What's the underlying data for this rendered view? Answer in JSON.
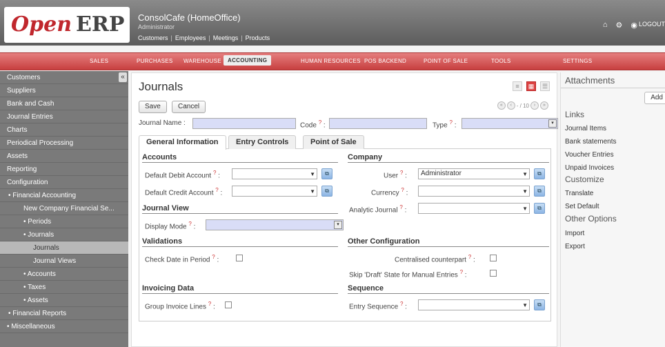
{
  "header": {
    "logo_open": "Open",
    "logo_erp": "ERP",
    "company": "ConsolCafe (HomeOffice)",
    "user": "Administrator",
    "shortcuts": [
      "Customers",
      "Employees",
      "Meetings",
      "Products"
    ],
    "logout": "LOGOUT"
  },
  "menu": [
    "SALES",
    "PURCHASES",
    "WAREHOUSE",
    "ACCOUNTING",
    "HUMAN RESOURCES",
    "POS BACKEND",
    "POINT OF SALE",
    "TOOLS",
    "SETTINGS"
  ],
  "menu_active": "ACCOUNTING",
  "sidebar": {
    "items": [
      "Customers",
      "Suppliers",
      "Bank and Cash",
      "Journal Entries",
      "Charts",
      "Periodical Processing",
      "Assets",
      "Reporting",
      "Configuration",
      "• Financial Accounting",
      "New Company Financial Se...",
      "• Periods",
      "• Journals",
      "Journals",
      "Journal Views",
      "• Accounts",
      "• Taxes",
      "• Assets",
      "• Financial Reports",
      "• Miscellaneous"
    ],
    "collapse": "«"
  },
  "main": {
    "title": "Journals",
    "save": "Save",
    "cancel": "Cancel",
    "pager": "- / 10",
    "journal_name_label": "Journal Name :",
    "code_label": "Code",
    "type_label": "Type",
    "tabs": [
      "General Information",
      "Entry Controls",
      "Point of Sale"
    ],
    "sections": {
      "accounts": "Accounts",
      "company": "Company",
      "journal_view": "Journal View",
      "validations": "Validations",
      "other_config": "Other Configuration",
      "invoicing": "Invoicing Data",
      "sequence": "Sequence"
    },
    "fields": {
      "default_debit": "Default Debit Account",
      "default_credit": "Default Credit Account",
      "user": "User",
      "user_value": "Administrator",
      "currency": "Currency",
      "analytic": "Analytic Journal",
      "display_mode": "Display Mode",
      "check_date": "Check Date in Period",
      "centralised": "Centralised counterpart",
      "skip_draft": "Skip 'Draft' State for Manual Entries",
      "group_invoice": "Group Invoice Lines",
      "entry_sequence": "Entry Sequence"
    },
    "q": "?"
  },
  "right": {
    "attachments": "Attachments",
    "add": "Add",
    "links": "Links",
    "link_items": [
      "Journal Items",
      "Bank statements",
      "Voucher Entries",
      "Unpaid Invoices"
    ],
    "customize": "Customize",
    "customize_items": [
      "Translate",
      "Set Default"
    ],
    "other": "Other Options",
    "other_items": [
      "Import",
      "Export"
    ]
  }
}
